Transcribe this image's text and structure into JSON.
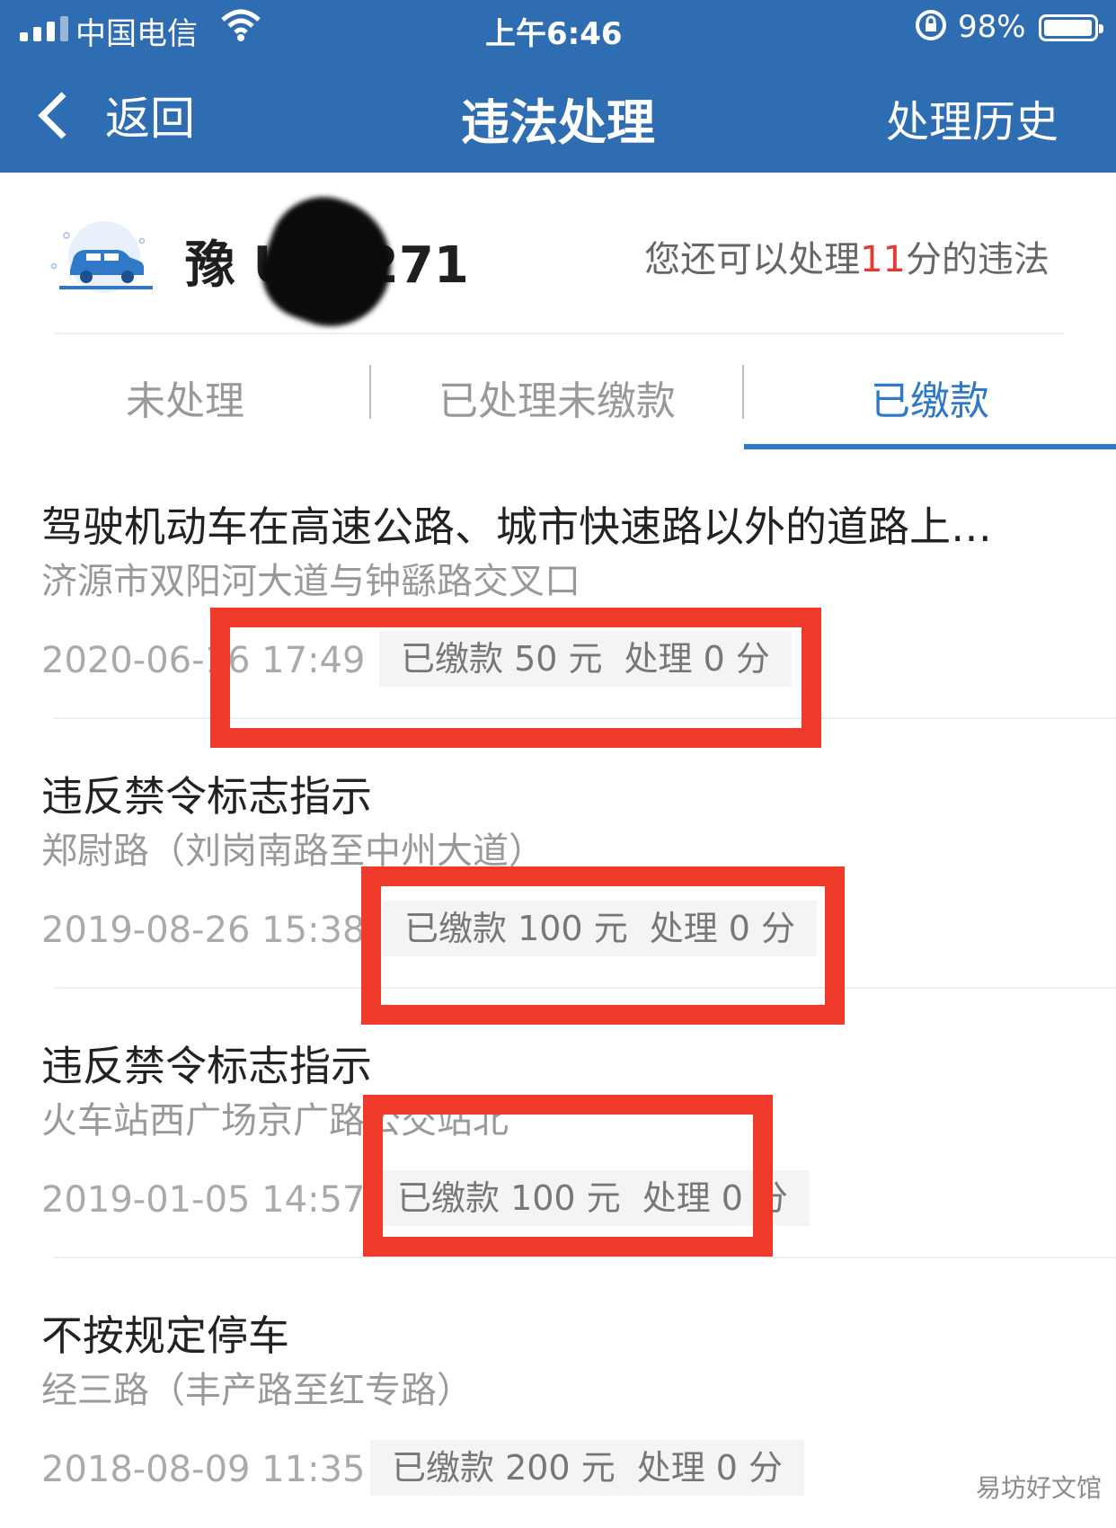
{
  "status_bar": {
    "carrier": "中国电信",
    "time": "上午6:46",
    "battery": "98%",
    "battery_level": 0.98
  },
  "nav": {
    "back_label": "返回",
    "title": "违法处理",
    "history_label": "处理历史"
  },
  "vehicle": {
    "plate": "豫 U08271",
    "quota_prefix": "您还可以处理",
    "quota_points": "11",
    "quota_suffix": "分的违法"
  },
  "tabs": [
    {
      "label": "未处理",
      "active": false
    },
    {
      "label": "已处理未缴款",
      "active": false
    },
    {
      "label": "已缴款",
      "active": true
    }
  ],
  "violations": [
    {
      "title": "驾驶机动车在高速公路、城市快速路以外的道路上…",
      "address": "济源市双阳河大道与钟繇路交叉口",
      "time": "2020-06-16 17:49",
      "paid": "已缴款 50 元",
      "points": "处理 0 分"
    },
    {
      "title": "违反禁令标志指示",
      "address": "郑尉路（刘岗南路至中州大道）",
      "time": "2019-08-26 15:38",
      "paid": "已缴款 100 元",
      "points": "处理 0 分"
    },
    {
      "title": "违反禁令标志指示",
      "address": "火车站西广场京广路公交站北",
      "time": "2019-01-05 14:57",
      "paid": "已缴款 100 元",
      "points": "处理 0 分"
    },
    {
      "title": "不按规定停车",
      "address": "经三路（丰产路至红专路）",
      "time": "2018-08-09 11:35",
      "paid": "已缴款 200 元",
      "points": "处理 0 分"
    }
  ],
  "watermark": "易坊好文馆",
  "colors": {
    "nav_bg": "#2f6db3",
    "accent": "#2f79c8",
    "highlight_red": "#f03a2c",
    "points_red": "#e23b33"
  }
}
